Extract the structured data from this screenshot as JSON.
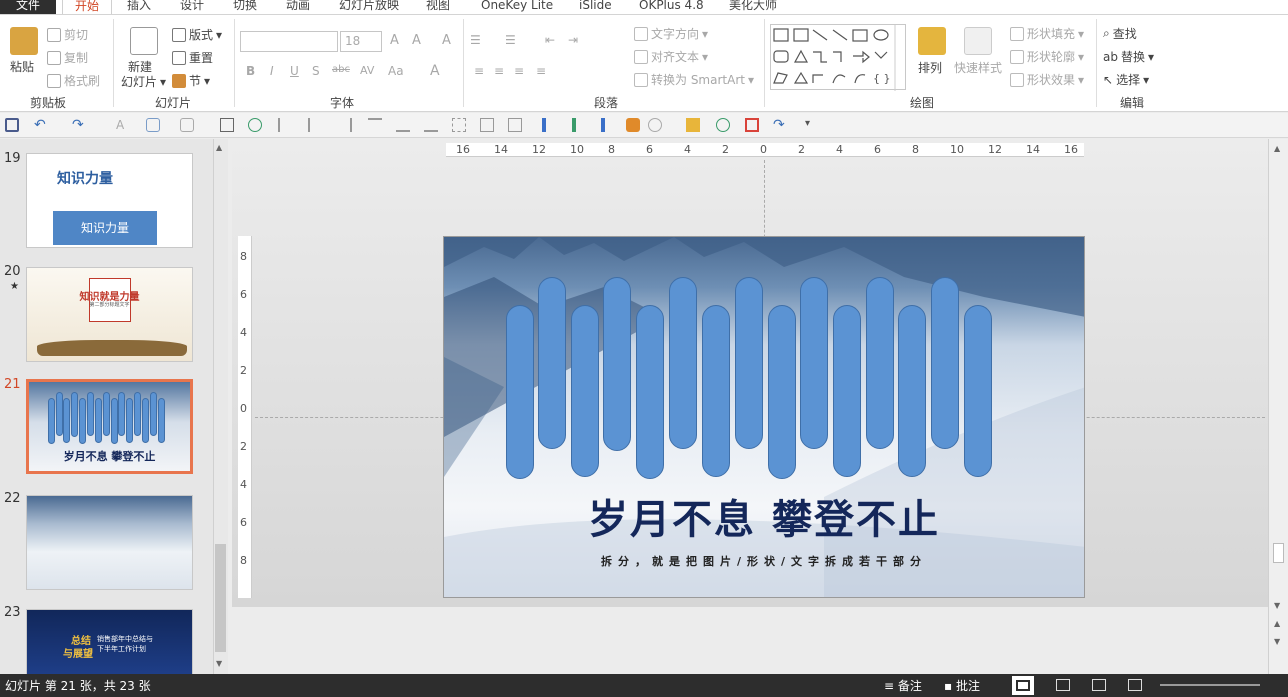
{
  "tabs": [
    "文件",
    "开始",
    "插入",
    "设计",
    "切换",
    "动画",
    "幻灯片放映",
    "视图",
    "OneKey Lite",
    "iSlide",
    "OKPlus 4.8",
    "美化大师"
  ],
  "ribbon": {
    "clipboard": {
      "paste": "粘贴",
      "cut": "剪切",
      "copy": "复制",
      "format_painter": "格式刷",
      "label": "剪贴板"
    },
    "slides": {
      "new_slide_1": "新建",
      "new_slide_2": "幻灯片",
      "layout": "版式",
      "reset": "重置",
      "section": "节",
      "label": "幻灯片"
    },
    "font": {
      "font_size": "18",
      "label": "字体",
      "bold": "B",
      "italic": "I",
      "underline": "U",
      "shadow": "S",
      "strike": "abc",
      "spacing": "AV",
      "case": "Aa",
      "color": "A",
      "grow": "A",
      "shrink": "A",
      "clear": "A"
    },
    "paragraph": {
      "text_direction": "文字方向",
      "align_text": "对齐文本",
      "smartart": "转换为 SmartArt",
      "label": "段落"
    },
    "drawing": {
      "arrange": "排列",
      "quick_styles": "快速样式",
      "shape_fill": "形状填充",
      "shape_outline": "形状轮廓",
      "shape_effects": "形状效果",
      "label": "绘图"
    },
    "editing": {
      "find": "查找",
      "replace": "替换",
      "select": "选择",
      "label": "编辑"
    }
  },
  "thumbnails": [
    {
      "num": "19",
      "star": "",
      "text_top": "知识力量",
      "text_box": "知识力量"
    },
    {
      "num": "20",
      "star": "★",
      "title": "知识就是力量",
      "subtitle": "第二部分标题文字"
    },
    {
      "num": "21",
      "star": "",
      "title": "岁月不息  攀登不止",
      "selected": true
    },
    {
      "num": "22",
      "star": ""
    },
    {
      "num": "23",
      "star": "",
      "t1": "总结",
      "t2": "与展望",
      "r1": "销售部年中总结与",
      "r2": "下半年工作计划"
    }
  ],
  "ruler": {
    "h_ticks": [
      "16",
      "14",
      "12",
      "10",
      "8",
      "6",
      "4",
      "2",
      "0",
      "2",
      "4",
      "6",
      "8",
      "10",
      "12",
      "14",
      "16"
    ],
    "v_ticks": [
      "8",
      "6",
      "4",
      "2",
      "0",
      "2",
      "4",
      "6",
      "8"
    ]
  },
  "slide": {
    "title": "岁月不息  攀登不止",
    "subtitle": "拆分，就是把图片/形状/文字拆成若干部分",
    "pill_color": "#5b93d3"
  },
  "status": {
    "slide_info": "幻灯片 第 21 张，共 23 张",
    "notes": "备注",
    "comments": "批注"
  }
}
